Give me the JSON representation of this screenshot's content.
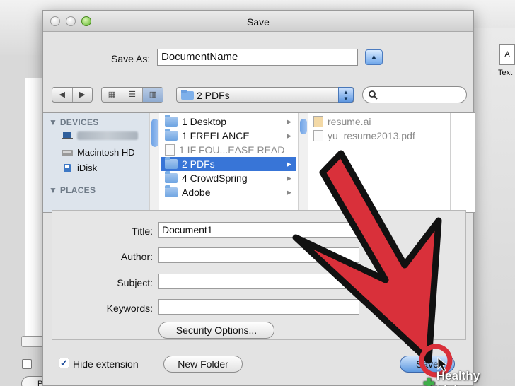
{
  "window": {
    "title": "Save"
  },
  "save_as": {
    "label": "Save As:",
    "value": "DocumentName"
  },
  "location": {
    "folder": "2 PDFs"
  },
  "sidebar": {
    "devices_header": "DEVICES",
    "items": [
      {
        "label": "Macintosh HD",
        "icon": "hard-drive-icon"
      },
      {
        "label": "iDisk",
        "icon": "idisk-icon"
      }
    ],
    "places_header": "PLACES"
  },
  "column1": [
    {
      "label": "1 Desktop"
    },
    {
      "label": "1 FREELANCE"
    },
    {
      "label": "1 IF FOU...EASE READ"
    },
    {
      "label": "2 PDFs"
    },
    {
      "label": "4 CrowdSpring"
    },
    {
      "label": "Adobe"
    }
  ],
  "column2": [
    {
      "label": "resume.ai"
    },
    {
      "label": "yu_resume2013.pdf"
    }
  ],
  "metadata": {
    "title_label": "Title:",
    "title_value": "Document1",
    "author_label": "Author:",
    "subject_label": "Subject:",
    "keywords_label": "Keywords:",
    "security_button": "Security Options..."
  },
  "bottom": {
    "hide_extension": "Hide extension",
    "new_folder": "New Folder",
    "save": "Save"
  },
  "background": {
    "text_label": "Text",
    "page_setup": "Page Setup..."
  },
  "watermark": "Healthy Living",
  "colors": {
    "selection": "#3875d7",
    "annotation_arrow": "#d9303a"
  }
}
